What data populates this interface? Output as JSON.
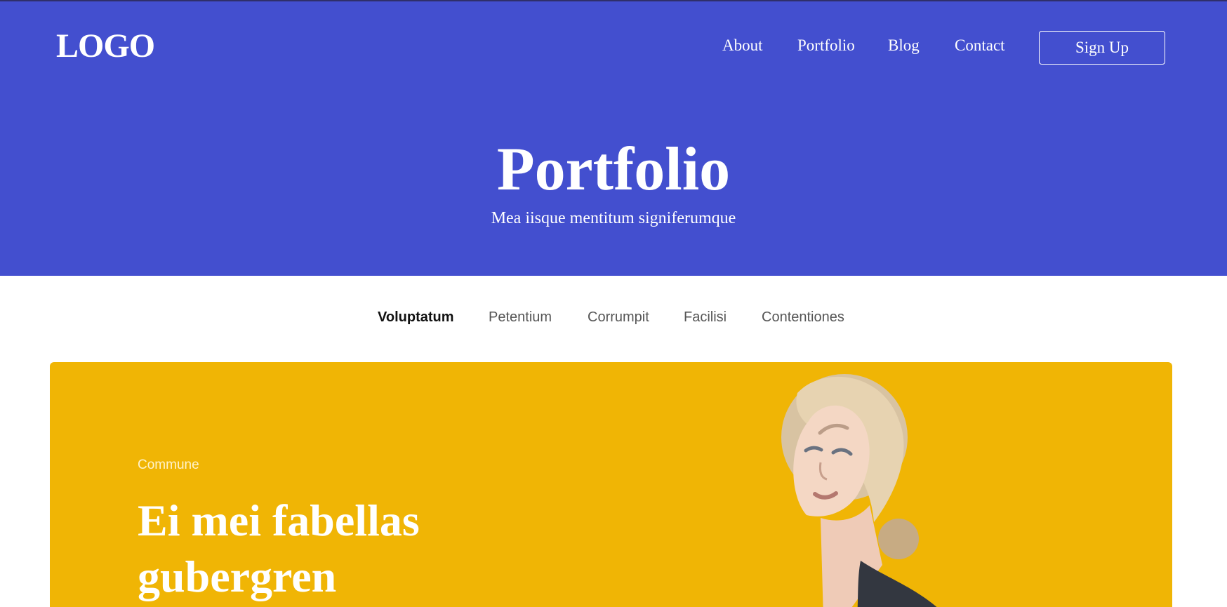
{
  "header": {
    "logo": "LOGO",
    "nav": [
      "About",
      "Portfolio",
      "Blog",
      "Contact"
    ],
    "signup_label": "Sign Up"
  },
  "hero": {
    "title": "Portfolio",
    "subtitle": "Mea iisque mentitum signiferumque"
  },
  "tabs": {
    "items": [
      "Voluptatum",
      "Petentium",
      "Corrumpit",
      "Facilisi",
      "Contentiones"
    ],
    "active": "Voluptatum"
  },
  "feature": {
    "eyebrow": "Commune",
    "title": "Ei mei fabellas gubergren",
    "image_alt": "portrait"
  },
  "colors": {
    "hero_bg": "#434fcf",
    "card_bg": "#f0b505",
    "text_light": "#ffffff"
  }
}
